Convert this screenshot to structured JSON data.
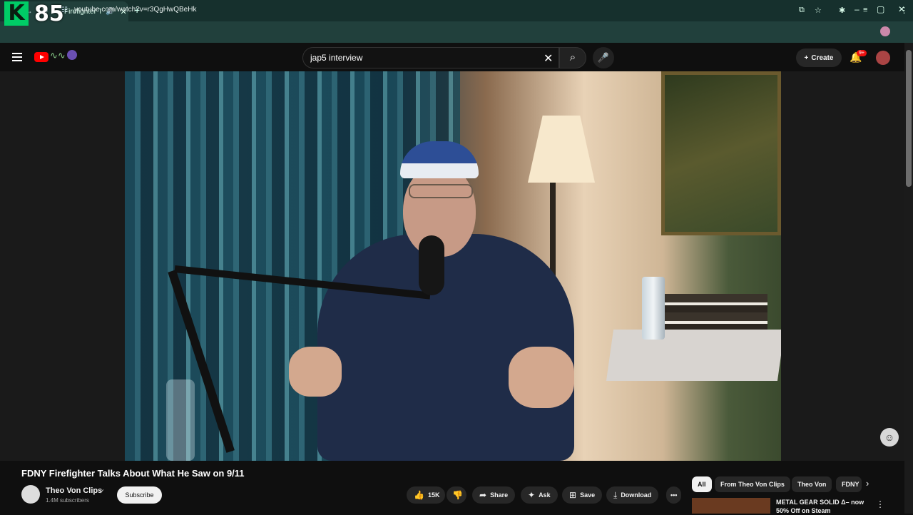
{
  "overlay": {
    "logo_letter": "K",
    "counter": "85"
  },
  "browser": {
    "tab_title": "Firefighter Talks",
    "new_tab": "+",
    "url": "youtube.com/watch?v=r3QgHwQBeHk",
    "controls": {
      "minimize": "–",
      "maximize": "▢",
      "close": "✕"
    }
  },
  "header": {
    "search_query": "jap5 interview",
    "create_label": "Create",
    "notification_badge": "9+"
  },
  "video": {
    "title": "FDNY Firefighter Talks About What He Saw on 9/11",
    "channel": "Theo Von Clips",
    "subscribers": "1.4M subscribers",
    "subscribe_label": "Subscribe",
    "actions": {
      "likes": "15K",
      "share": "Share",
      "ask": "Ask",
      "save": "Save",
      "download": "Download",
      "more": "•••"
    }
  },
  "chips": [
    "All",
    "From Theo Von Clips",
    "Theo Von",
    "FDNY"
  ],
  "recommendation": {
    "title": "METAL GEAR SOLID Δ– now 50% Off on Steam"
  },
  "colors": {
    "background": "#0f0f0f",
    "browser_tabbar": "#16302d",
    "browser_addressbar": "#21403c",
    "youtube_red": "#ff0000",
    "chip_active": "#f1f1f1"
  },
  "icons": [
    "menu-icon",
    "youtube-logo-icon",
    "search-icon",
    "clear-icon",
    "mic-icon",
    "plus-icon",
    "bell-icon",
    "like-icon",
    "dislike-icon",
    "share-icon",
    "ask-icon",
    "save-icon",
    "download-icon",
    "more-icon",
    "chevron-right-icon"
  ]
}
